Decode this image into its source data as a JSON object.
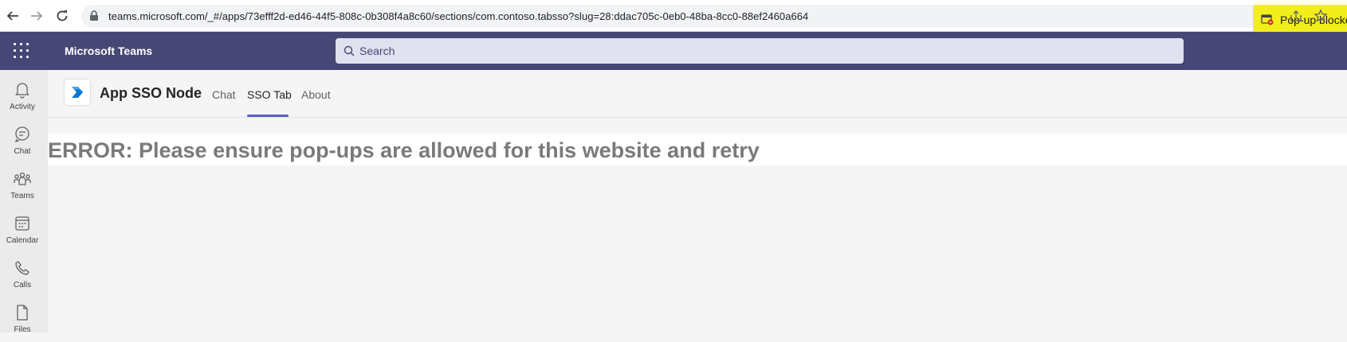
{
  "browser": {
    "url": "teams.microsoft.com/_#/apps/73efff2d-ed46-44f5-808c-0b308f4a8c60/sections/com.contoso.tabsso?slug=28:ddac705c-0eb0-48ba-8cc0-88ef2460a664",
    "popup_blocked_label": "Pop-up blocked",
    "popup_highlight_color": "#f2ee1c"
  },
  "teams": {
    "app_name": "Microsoft Teams",
    "search_placeholder": "Search",
    "header_color": "#464775"
  },
  "rail": {
    "items": [
      {
        "label": "Activity",
        "icon": "bell-icon"
      },
      {
        "label": "Chat",
        "icon": "chat-icon"
      },
      {
        "label": "Teams",
        "icon": "teams-icon"
      },
      {
        "label": "Calendar",
        "icon": "calendar-icon"
      },
      {
        "label": "Calls",
        "icon": "phone-icon"
      },
      {
        "label": "Files",
        "icon": "file-icon"
      }
    ]
  },
  "tab_header": {
    "app_title": "App SSO Node",
    "tabs": [
      {
        "label": "Chat",
        "active": false
      },
      {
        "label": "SSO Tab",
        "active": true
      },
      {
        "label": "About",
        "active": false
      }
    ],
    "accent_color": "#5b5fc7"
  },
  "content": {
    "error_message": "ERROR: Please ensure pop-ups are allowed for this website and retry"
  }
}
